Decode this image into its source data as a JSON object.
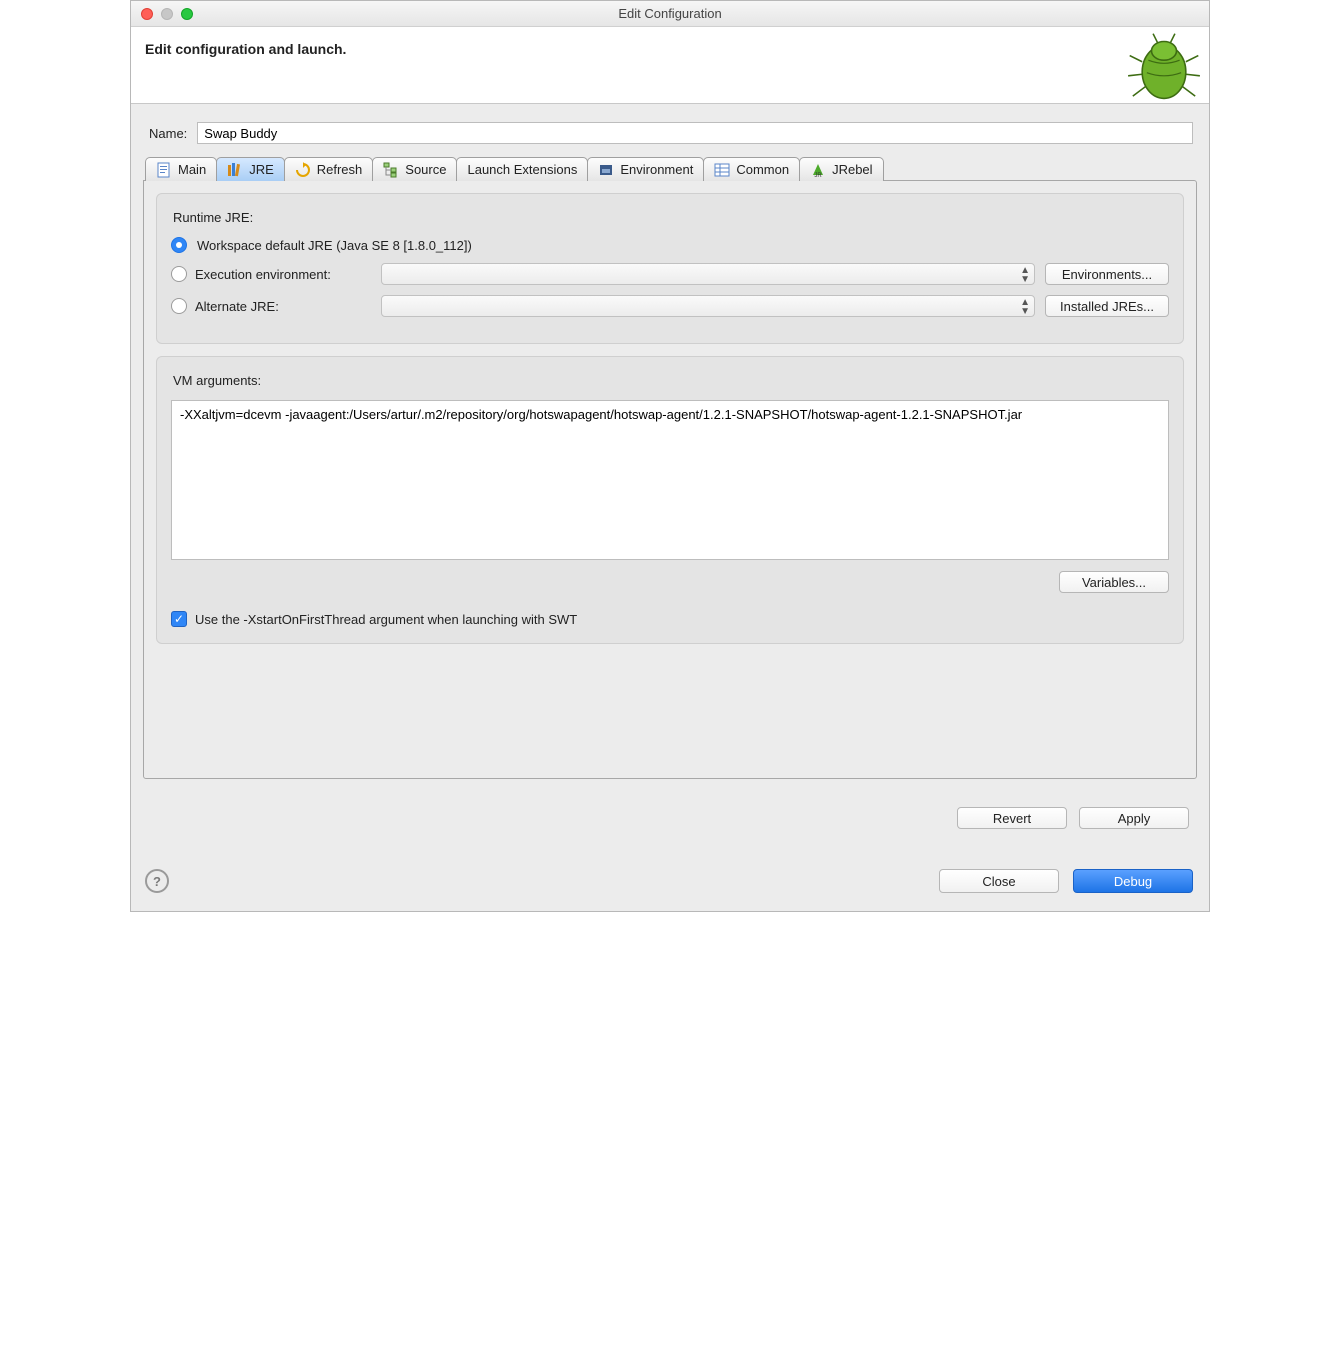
{
  "window": {
    "title": "Edit Configuration"
  },
  "banner": {
    "heading": "Edit configuration and launch."
  },
  "form": {
    "name_label": "Name:",
    "name_value": "Swap Buddy"
  },
  "tabs": [
    {
      "id": "main",
      "label": "Main"
    },
    {
      "id": "jre",
      "label": "JRE"
    },
    {
      "id": "refresh",
      "label": "Refresh"
    },
    {
      "id": "source",
      "label": "Source"
    },
    {
      "id": "launch",
      "label": "Launch Extensions"
    },
    {
      "id": "env",
      "label": "Environment"
    },
    {
      "id": "common",
      "label": "Common"
    },
    {
      "id": "jrebel",
      "label": "JRebel"
    }
  ],
  "active_tab": "jre",
  "jre": {
    "group_title": "Runtime JRE:",
    "options": {
      "workspace_default": "Workspace default JRE (Java SE 8 [1.8.0_112])",
      "execution_env": "Execution environment:",
      "alternate_jre": "Alternate JRE:"
    },
    "buttons": {
      "environments": "Environments...",
      "installed_jres": "Installed JREs..."
    }
  },
  "vm": {
    "group_title": "VM arguments:",
    "value": "-XXaltjvm=dcevm -javaagent:/Users/artur/.m2/repository/org/hotswapagent/hotswap-agent/1.2.1-SNAPSHOT/hotswap-agent-1.2.1-SNAPSHOT.jar",
    "variables_btn": "Variables...",
    "swt_checkbox": "Use the -XstartOnFirstThread argument when launching with SWT"
  },
  "actions": {
    "revert": "Revert",
    "apply": "Apply",
    "close": "Close",
    "debug": "Debug"
  }
}
